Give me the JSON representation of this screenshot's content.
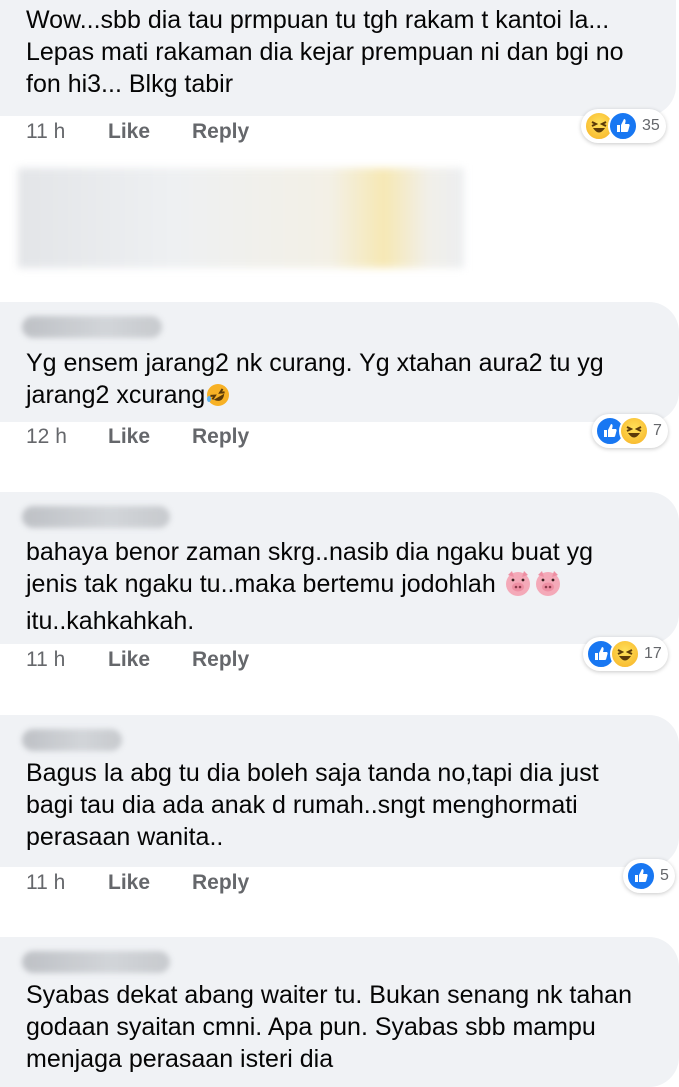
{
  "comments": [
    {
      "text": "Wow...sbb dia tau prmpuan tu tgh rakam t kantoi la...\nLepas mati rakaman dia kejar prempuan ni dan bgi no\nfon hi3... Blkg tabir",
      "time": "11 h",
      "like": "Like",
      "reply": "Reply",
      "reactions": [
        "haha-icon",
        "like-icon"
      ],
      "count": "35"
    },
    {
      "text": "Yg ensem jarang2 nk curang. Yg xtahan aura2 tu yg\njarang2 xcurang",
      "trailing_emoji": "rolling-laughing-emoji",
      "time": "12 h",
      "like": "Like",
      "reply": "Reply",
      "reactions": [
        "like-icon",
        "haha-icon"
      ],
      "count": "7"
    },
    {
      "text_line1": "bahaya benor zaman skrg..nasib dia ngaku buat yg",
      "text_line2": "jenis tak ngaku tu..maka bertemu jodohlah",
      "text_line3": "itu..kahkahkah.",
      "trailing_emoji": "pig-face-emoji",
      "time": "11 h",
      "like": "Like",
      "reply": "Reply",
      "reactions": [
        "like-icon",
        "haha-icon"
      ],
      "count": "17"
    },
    {
      "text": "Bagus la abg tu dia boleh saja tanda no,tapi dia just\nbagi tau dia ada anak d rumah..sngt menghormati\nperasaan wanita..",
      "time": "11 h",
      "like": "Like",
      "reply": "Reply",
      "reactions": [
        "like-icon"
      ],
      "count": "5"
    },
    {
      "text": "Syabas dekat abang waiter tu. Bukan senang nk tahan\ngodaan syaitan cmni. Apa pun. Syabas sbb mampu\nmenjaga perasaan isteri dia"
    }
  ],
  "colors": {
    "bubble": "#f0f2f5",
    "meta_text": "#65676b",
    "like_blue": "#1877f2",
    "haha_yellow": "#f7b125"
  }
}
